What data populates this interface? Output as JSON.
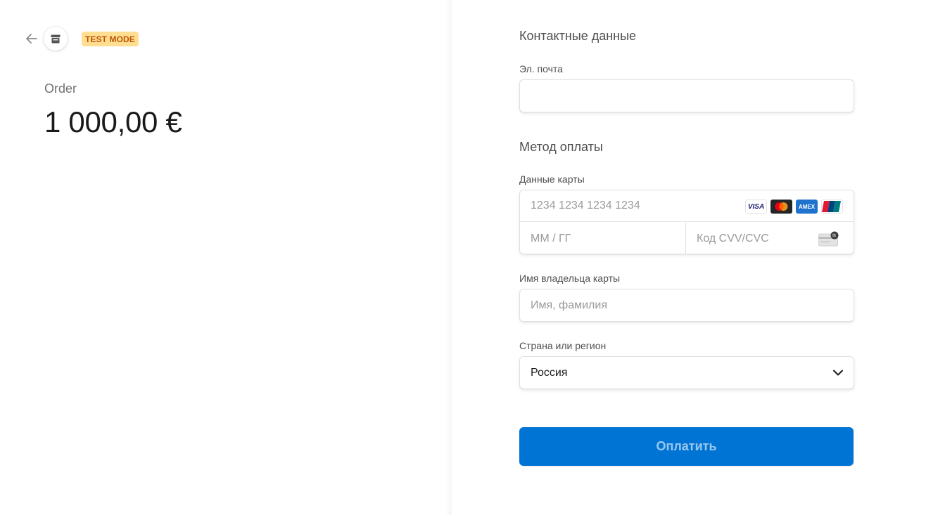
{
  "header": {
    "back_icon": "arrow-left-icon",
    "store_icon": "store-icon",
    "test_mode_label": "TEST MODE"
  },
  "order": {
    "label": "Order",
    "amount": "1 000,00 €"
  },
  "contact": {
    "section_title": "Контактные данные",
    "email_label": "Эл. почта",
    "email_value": "",
    "email_placeholder": ""
  },
  "payment": {
    "section_title": "Метод оплаты",
    "card_label": "Данные карты",
    "card_number_placeholder": "1234 1234 1234 1234",
    "expiry_placeholder": "ММ / ГГ",
    "cvc_placeholder": "Код CVV/CVC",
    "brands": [
      "visa",
      "mastercard",
      "amex",
      "unionpay"
    ],
    "visa_text": "VISA",
    "amex_text": "AMEX",
    "cvc_icon": "cvc-card-icon"
  },
  "cardholder": {
    "label": "Имя владельца карты",
    "placeholder": "Имя, фамилия"
  },
  "country": {
    "label": "Страна или регион",
    "selected": "Россия",
    "icon": "chevron-down-icon"
  },
  "pay_button": {
    "label": "Оплатить"
  },
  "colors": {
    "accent": "#0074d4",
    "badge_bg": "#ffde92",
    "badge_text": "#bb5504"
  }
}
